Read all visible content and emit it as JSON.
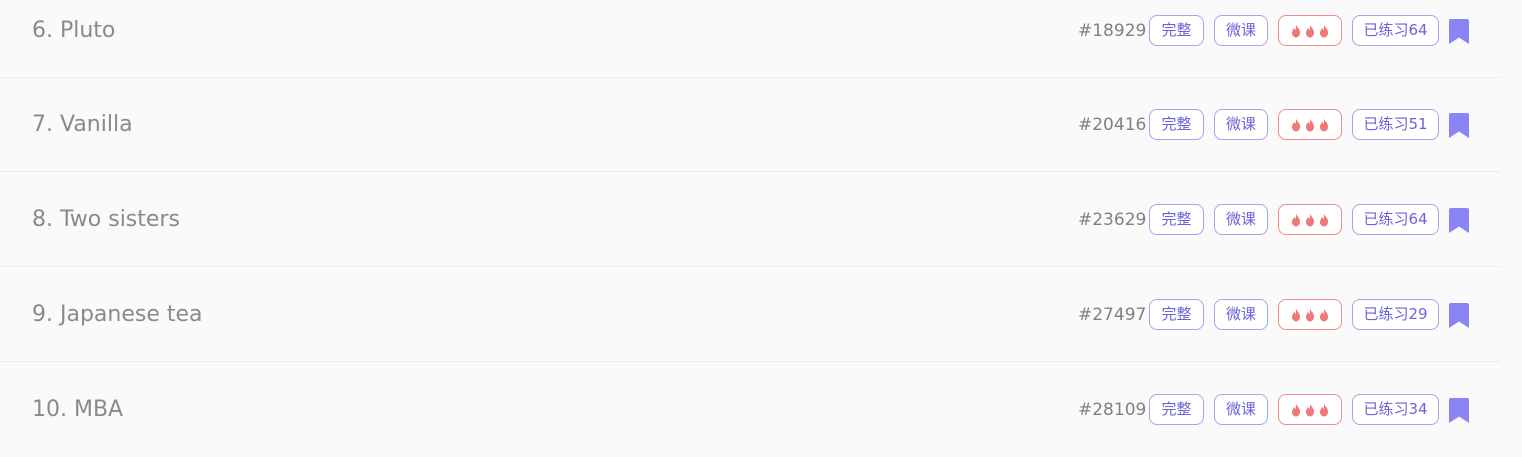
{
  "tag_labels": {
    "complete": "完整",
    "video": "微课"
  },
  "icons": {
    "hot": "flame-icon",
    "bookmark": "bookmark-icon"
  },
  "colors": {
    "tag_purple": "#6c63d6",
    "tag_border": "#a9a3e8",
    "hot_red": "#f07878",
    "bookmark": "#8a84f4"
  },
  "rows": [
    {
      "title": "6. Pluto",
      "id": "#18929",
      "practiced": "已练习64"
    },
    {
      "title": "7. Vanilla",
      "id": "#20416",
      "practiced": "已练习51"
    },
    {
      "title": "8. Two sisters",
      "id": "#23629",
      "practiced": "已练习64"
    },
    {
      "title": "9. Japanese tea",
      "id": "#27497",
      "practiced": "已练习29"
    },
    {
      "title": "10. MBA",
      "id": "#28109",
      "practiced": "已练习34"
    }
  ]
}
